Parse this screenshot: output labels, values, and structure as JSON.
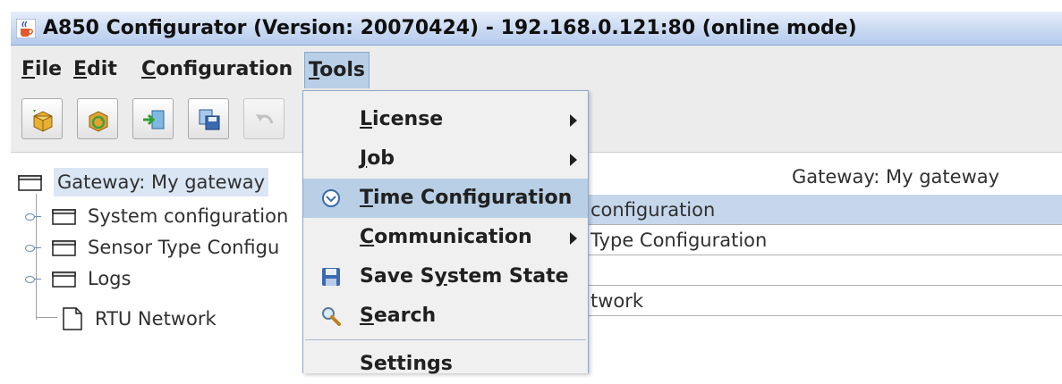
{
  "window": {
    "title": "A850 Configurator (Version: 20070424) - 192.168.0.121:80 (online mode)",
    "icon": "java-cup-icon"
  },
  "menubar": {
    "items": [
      {
        "label_u": "F",
        "label_rest": "ile"
      },
      {
        "label_u": "E",
        "label_rest": "dit"
      },
      {
        "label_u": "C",
        "label_rest": "onfiguration"
      },
      {
        "label_u": "T",
        "label_rest": "ools"
      }
    ],
    "open_menu": "Tools"
  },
  "toolbar": {
    "buttons": [
      "new-package-icon",
      "refresh-package-icon",
      "import-icon",
      "save-copy-icon",
      "undo-icon"
    ]
  },
  "tree": {
    "root": "Gateway: My gateway",
    "children": [
      "System configuration",
      "Sensor Type Configu",
      "Logs",
      "RTU Network"
    ]
  },
  "table": {
    "header": "Gateway: My gateway",
    "rows": [
      "configuration",
      "Type Configuration",
      "",
      "twork"
    ]
  },
  "tools_menu": {
    "items": [
      {
        "u": "L",
        "rest": "icense",
        "submenu": true
      },
      {
        "u": "J",
        "rest": "ob",
        "submenu": true
      },
      {
        "u": "T",
        "rest": "ime Configuration",
        "icon": "clock-icon",
        "highlighted": true
      },
      {
        "u": "C",
        "rest": "ommunication",
        "submenu": true
      },
      {
        "pre": "Save S",
        "u": "y",
        "rest": "stem State",
        "icon": "floppy-disk-icon"
      },
      {
        "u": "S",
        "rest": "earch",
        "icon": "magnifier-icon"
      },
      {
        "label": "Settings"
      }
    ]
  },
  "colors": {
    "menu_highlight": "#b8cfe5",
    "title_bar": "#c9d9f1",
    "row_selected": "#c6d7ec"
  }
}
